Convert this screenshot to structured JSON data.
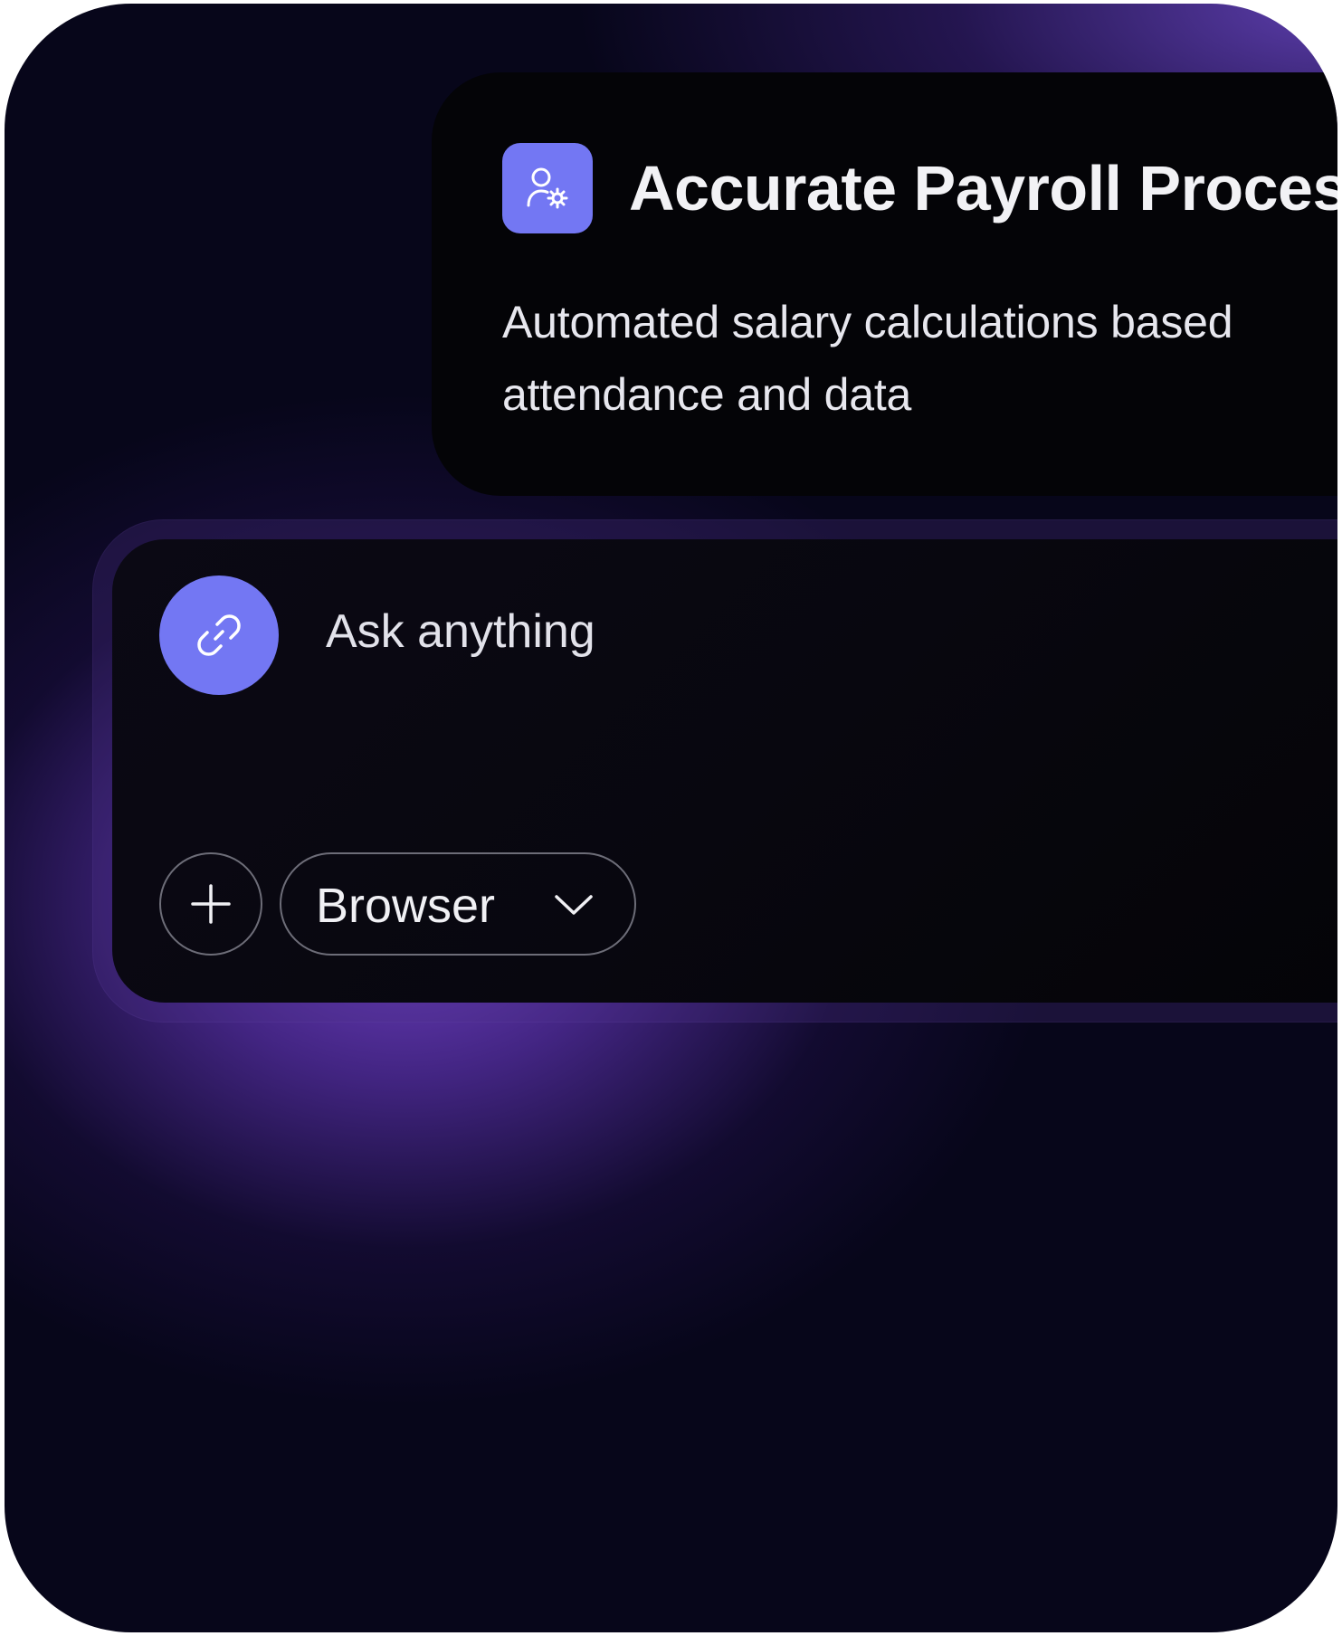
{
  "feature_card": {
    "icon": "user-gear-icon",
    "title": "Accurate Payroll Processi",
    "description": "Automated salary calculations based attendance and data"
  },
  "chat_input": {
    "attach_icon": "link-icon",
    "placeholder": "Ask anything",
    "add_icon": "plus-icon",
    "mode_select": {
      "selected": "Browser",
      "icon": "chevron-down-icon"
    }
  },
  "colors": {
    "accent": "#7377f3",
    "background": "#07061a",
    "glow": "#6a3fc4",
    "card": "#040407"
  }
}
